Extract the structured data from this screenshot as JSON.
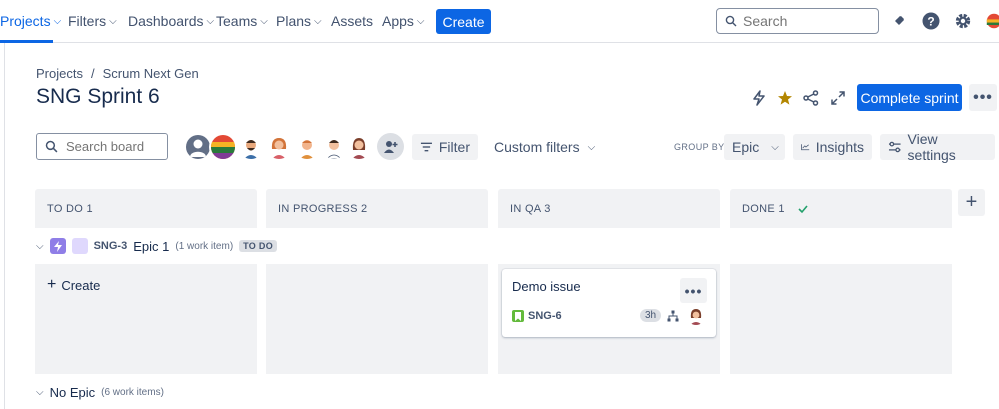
{
  "nav": {
    "items": [
      {
        "label": "Projects"
      },
      {
        "label": "Filters"
      },
      {
        "label": "Dashboards"
      },
      {
        "label": "Teams"
      },
      {
        "label": "Plans"
      },
      {
        "label": "Assets"
      },
      {
        "label": "Apps"
      }
    ],
    "create_label": "Create",
    "search_placeholder": "Search",
    "accent": "#0c66e4"
  },
  "header": {
    "breadcrumb": [
      "Projects",
      "/",
      "Scrum Next Gen"
    ],
    "title": "SNG Sprint 6",
    "complete_sprint_label": "Complete sprint",
    "icons": [
      "automation-icon",
      "star-icon",
      "share-icon",
      "fullscreen-icon"
    ]
  },
  "toolbar": {
    "search_placeholder": "Search board",
    "filter_label": "Filter",
    "custom_filters_label": "Custom filters",
    "group_by_label": "GROUP BY",
    "group_by_value": "Epic",
    "insights_label": "Insights",
    "view_settings_label": "View settings"
  },
  "columns": [
    {
      "name": "TO DO 1"
    },
    {
      "name": "IN PROGRESS 2"
    },
    {
      "name": "IN QA 3"
    },
    {
      "name": "DONE 1",
      "done": true
    }
  ],
  "epic": {
    "key": "SNG-3",
    "name": "Epic 1",
    "count": "(1 work item)",
    "status": "TO DO"
  },
  "create_in_column_label": "Create",
  "card": {
    "title": "Demo issue",
    "key": "SNG-6",
    "estimate": "3h"
  },
  "no_epic": {
    "label": "No Epic",
    "count": "(6 work items)"
  }
}
